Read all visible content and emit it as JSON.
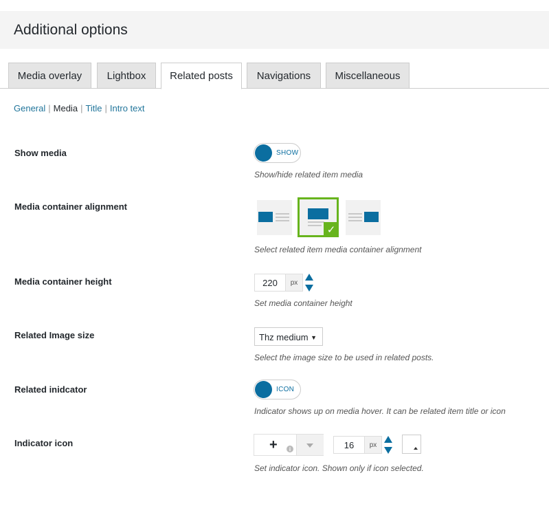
{
  "page": {
    "title": "Additional options"
  },
  "tabs": [
    {
      "label": "Media overlay"
    },
    {
      "label": "Lightbox"
    },
    {
      "label": "Related posts"
    },
    {
      "label": "Navigations"
    },
    {
      "label": "Miscellaneous"
    }
  ],
  "active_tab": "Related posts",
  "subnav": {
    "items": [
      "General",
      "Media",
      "Title",
      "Intro text"
    ],
    "separator": "|",
    "current": "Media"
  },
  "fields": {
    "show_media": {
      "label": "Show media",
      "toggle_text": "SHOW",
      "description": "Show/hide related item media"
    },
    "alignment": {
      "label": "Media container alignment",
      "options": [
        "left",
        "center",
        "right"
      ],
      "selected": "center",
      "selected_mark": "✓",
      "description": "Select related item media container alignment"
    },
    "height": {
      "label": "Media container height",
      "value": "220",
      "unit": "px",
      "description": "Set media container height"
    },
    "image_size": {
      "label": "Related Image size",
      "value": "Thz medium",
      "caret": "▼",
      "description": "Select the image size to be used in related posts."
    },
    "indicator": {
      "label": "Related inidcator",
      "toggle_text": "ICON",
      "description": "Indicator shows up on media hover. It can be related item title or icon"
    },
    "indicator_icon": {
      "label": "Indicator icon",
      "icon_glyph": "+",
      "info_glyph": "i",
      "size_value": "16",
      "size_unit": "px",
      "description": "Set indicator icon. Shown only if icon selected."
    }
  },
  "colors": {
    "accent": "#0b6ea0",
    "selected_border": "#67b41d",
    "link": "#21759b"
  }
}
